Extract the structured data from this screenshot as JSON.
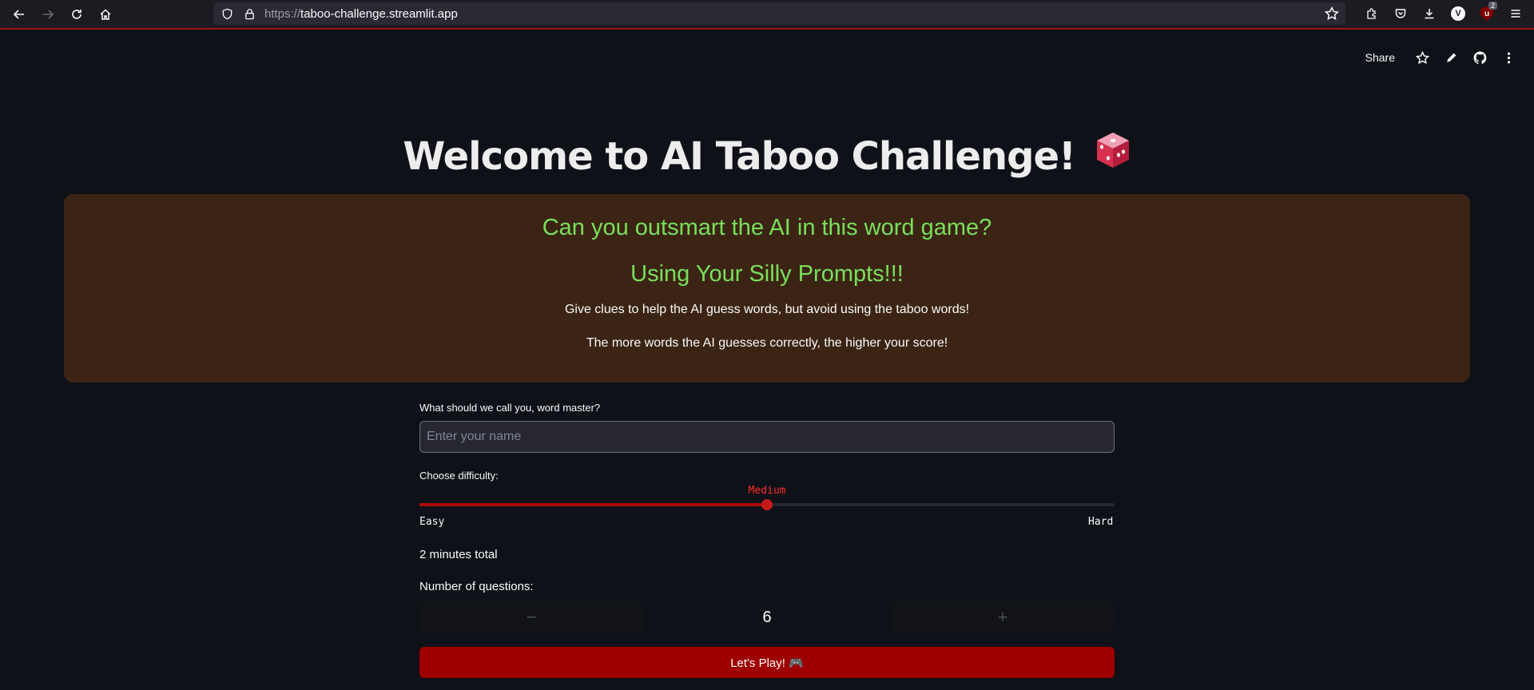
{
  "browser": {
    "url_protocol": "https://",
    "url_host": "taboo-challenge.streamlit.app",
    "extension_badge": "2",
    "profile_initial": "V",
    "ublock_letter": "u"
  },
  "toolbar": {
    "share_label": "Share"
  },
  "header": {
    "title": "Welcome to AI Taboo Challenge!"
  },
  "hero": {
    "headline": "Can you outsmart the AI in this word game?",
    "subheadline": "Using Your Silly Prompts!!!",
    "line1": "Give clues to help the AI guess words, but avoid using the taboo words!",
    "line2": "The more words the AI guesses correctly, the higher your score!"
  },
  "form": {
    "name_label": "What should we call you, word master?",
    "name_placeholder": "Enter your name",
    "name_value": "",
    "difficulty_label": "Choose difficulty:",
    "difficulty_value": "Medium",
    "difficulty_options": [
      "Easy",
      "Medium",
      "Hard"
    ],
    "difficulty_min_label": "Easy",
    "difficulty_max_label": "Hard",
    "difficulty_fraction": 0.5,
    "time_text": "2 minutes total",
    "questions_label": "Number of questions:",
    "questions_value": "6",
    "minus_symbol": "−",
    "plus_symbol": "+",
    "play_label": "Let's Play! 🎮"
  },
  "colors": {
    "background": "#0e1117",
    "hero_bg": "#3c2414",
    "hero_text_green": "#78e05a",
    "accent_red": "#9e0000",
    "slider_value_red": "#ff2b2b"
  }
}
